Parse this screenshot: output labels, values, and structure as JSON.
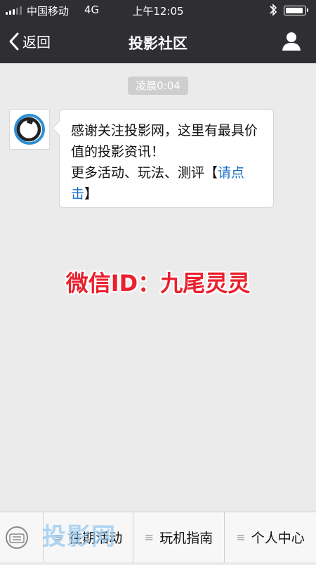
{
  "status_bar": {
    "carrier": "中国移动",
    "network": "4G",
    "time": "上午12:05"
  },
  "nav": {
    "back_label": "返回",
    "title": "投影社区"
  },
  "chat": {
    "timestamp": "凌晨0:04",
    "message": {
      "line1": "感谢关注投影网，这里有最具价值的投影资讯！",
      "line2_prefix": "更多活动、玩法、测评【",
      "link_text": "请点击",
      "line2_suffix": "】"
    }
  },
  "watermark": "微信ID：九尾灵灵",
  "bottom_menu": {
    "items": [
      {
        "label": "往期活动",
        "icon": "menu-lines-icon"
      },
      {
        "label": "玩机指南",
        "icon": "menu-lines-icon"
      },
      {
        "label": "个人中心",
        "icon": "menu-lines-icon"
      }
    ]
  },
  "site_watermark": "投影网",
  "colors": {
    "header_bg": "#2e2e33",
    "chat_bg": "#ebebeb",
    "link": "#1a6fc4",
    "watermark": "#e8212f"
  }
}
